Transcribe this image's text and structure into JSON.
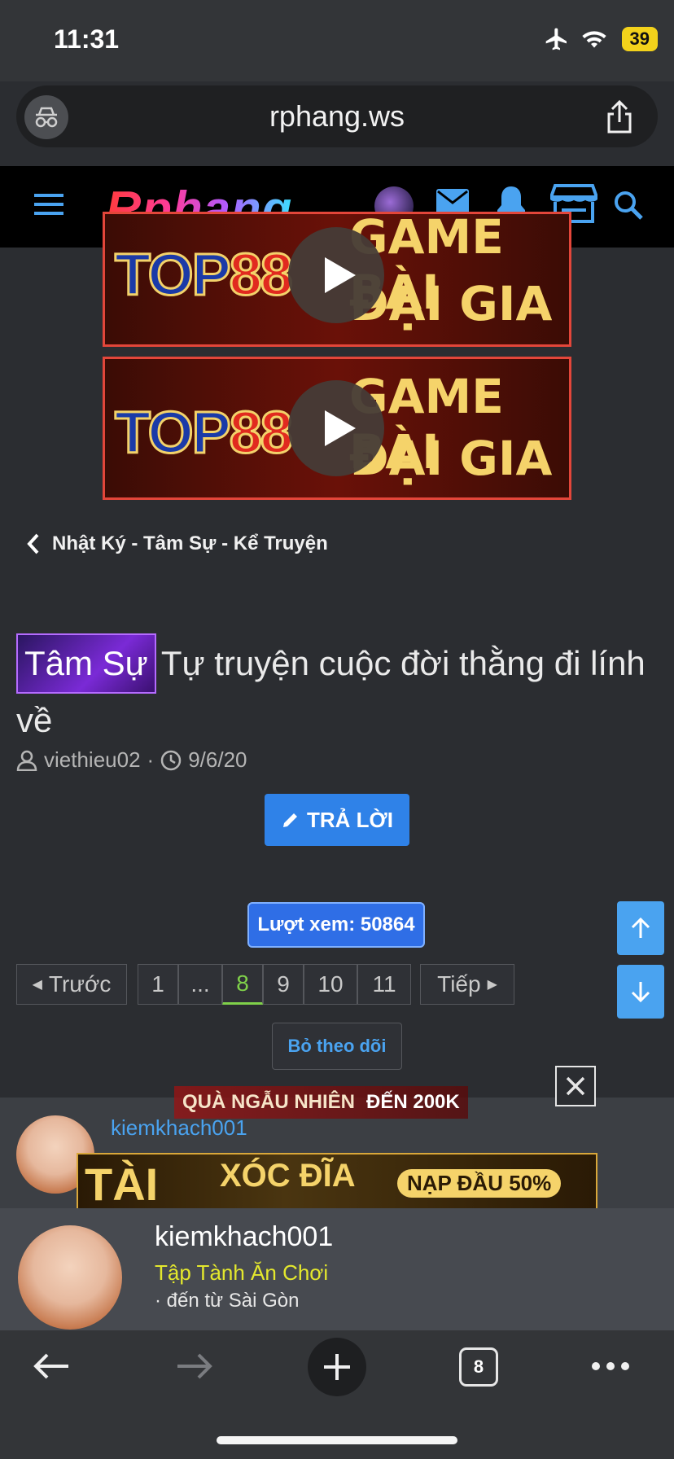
{
  "status": {
    "time": "11:31",
    "battery": "39"
  },
  "browser": {
    "url": "rphang.ws",
    "tab_count": "8"
  },
  "site": {
    "logo_text": "Rphang"
  },
  "banners": [
    {
      "brand_top": "TOP",
      "brand_num": "88",
      "title_line1": "GAME BÀI",
      "title_line2": "ĐẠI GIA"
    },
    {
      "brand_top": "TOP",
      "brand_num": "88",
      "title_line1": "GAME BÀI",
      "title_line2": "ĐẠI GIA"
    }
  ],
  "breadcrumb": {
    "label": "Nhật Ký - Tâm Sự - Kể Truyện"
  },
  "thread": {
    "prefix": "Tâm Sự",
    "title": "Tự truyện cuộc đời thằng đi lính về",
    "author": "viethieu02",
    "date": "9/6/20"
  },
  "actions": {
    "reply_label": "TRẢ LỜI",
    "views_label": "Lượt xem: 50864",
    "unwatch_label": "Bỏ theo dõi"
  },
  "pagination": {
    "prev": "Trước",
    "next": "Tiếp",
    "pages": [
      "1",
      "...",
      "8",
      "9",
      "10",
      "11"
    ],
    "current": "8"
  },
  "ad": {
    "promo_left": "QUÀ NGẪU NHIÊN",
    "promo_right": "ĐẾN 200K",
    "line1": "TÀI",
    "line2": "XÓC ĐĨA",
    "line3": "NẠP ĐẦU 50%"
  },
  "post": {
    "username": "kiemkhach001"
  },
  "user_card": {
    "name": "kiemkhach001",
    "rank": "Tập Tành Ăn Chơi",
    "from": "· đến từ Sài Gòn"
  },
  "colors": {
    "accent": "#2f82e8",
    "rank": "#e4e82d",
    "active_page": "#7fd14a"
  }
}
